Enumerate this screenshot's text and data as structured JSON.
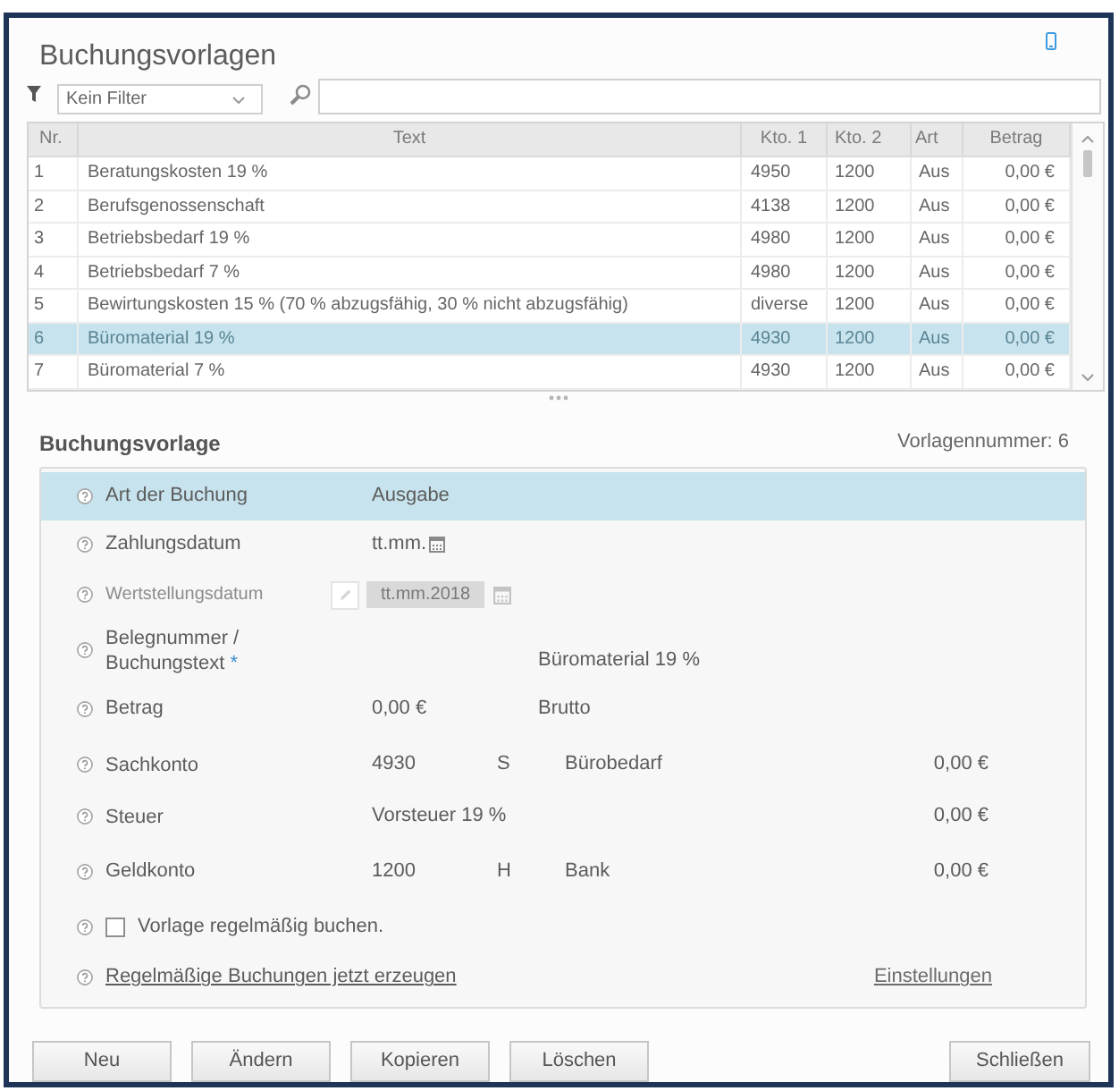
{
  "window": {
    "title": "Buchungsvorlagen"
  },
  "filter": {
    "value": "Kein Filter"
  },
  "table": {
    "columns": [
      "Nr.",
      "Text",
      "Kto. 1",
      "Kto. 2",
      "Art",
      "Betrag"
    ],
    "rows": [
      {
        "cells": [
          "1",
          "Beratungskosten 19 %",
          "4950",
          "1200",
          "Aus",
          "0,00 €"
        ],
        "selected": false
      },
      {
        "cells": [
          "2",
          "Berufsgenossenschaft",
          "4138",
          "1200",
          "Aus",
          "0,00 €"
        ],
        "selected": false
      },
      {
        "cells": [
          "3",
          "Betriebsbedarf 19 %",
          "4980",
          "1200",
          "Aus",
          "0,00 €"
        ],
        "selected": false
      },
      {
        "cells": [
          "4",
          "Betriebsbedarf 7 %",
          "4980",
          "1200",
          "Aus",
          "0,00 €"
        ],
        "selected": false
      },
      {
        "cells": [
          "5",
          "Bewirtungskosten 15 % (70 % abzugsfähig, 30 % nicht abzugsfähig)",
          "diverse",
          "1200",
          "Aus",
          "0,00 €"
        ],
        "selected": false
      },
      {
        "cells": [
          "6",
          "Büromaterial 19 %",
          "4930",
          "1200",
          "Aus",
          "0,00 €"
        ],
        "selected": true
      },
      {
        "cells": [
          "7",
          "Büromaterial 7 %",
          "4930",
          "1200",
          "Aus",
          "0,00 €"
        ],
        "selected": false
      }
    ]
  },
  "detail": {
    "title": "Buchungsvorlage",
    "number": "Vorlagennummer: 6",
    "fields": [
      {
        "kind": "text",
        "label": "Art der Buchung",
        "selected": true,
        "value": "Ausgabe"
      },
      {
        "kind": "date",
        "label": "Zahlungsdatum",
        "selected": false,
        "value": "tt.mm."
      },
      {
        "kind": "locked_date",
        "label": "Wertstellungsdatum",
        "selected": false,
        "value": "tt.mm.2018"
      },
      {
        "kind": "text",
        "label": "Belegnummer / Buchungstext",
        "required_mark": "*",
        "selected": false,
        "note": "Büromaterial 19 %"
      },
      {
        "kind": "text",
        "label": "Betrag",
        "selected": false,
        "value": "0,00 €",
        "note": "Brutto"
      },
      {
        "kind": "account",
        "label": "Sachkonto",
        "selected": false,
        "value": "4930",
        "side": "S",
        "note": "Bürobedarf",
        "amount": "0,00 €"
      },
      {
        "kind": "text",
        "label": "Steuer",
        "selected": false,
        "value": "Vorsteuer 19 %",
        "amount": "0,00 €"
      },
      {
        "kind": "account",
        "label": "Geldkonto",
        "selected": false,
        "value": "1200",
        "side": "H",
        "note": "Bank",
        "amount": "0,00 €"
      },
      {
        "kind": "checkbox",
        "label": "Vorlage regelmäßig buchen.",
        "selected": false,
        "checked": false
      },
      {
        "kind": "links",
        "selected": false,
        "link": "Regelmäßige Buchungen jetzt erzeugen",
        "side_link": "Einstellungen"
      }
    ]
  },
  "buttons": [
    {
      "label": "Neu"
    },
    {
      "label": "Ändern"
    },
    {
      "label": "Kopieren"
    },
    {
      "label": "Löschen"
    }
  ],
  "close_button": {
    "label": "Schließen"
  }
}
